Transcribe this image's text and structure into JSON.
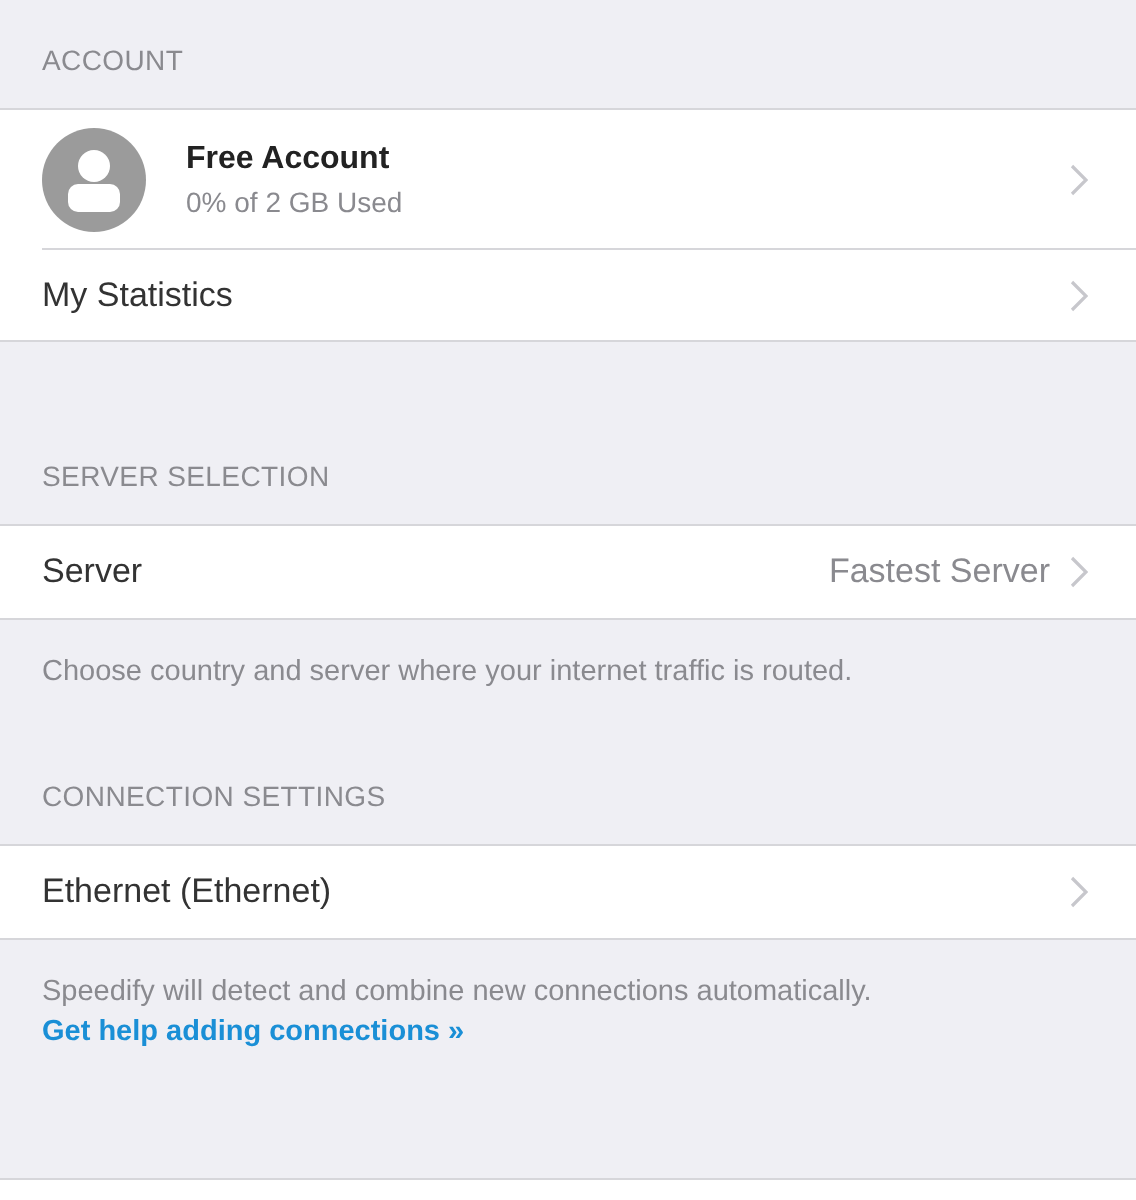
{
  "sections": [
    {
      "header": "ACCOUNT",
      "rows": [
        {
          "kind": "account",
          "title": "Free Account",
          "subtitle": "0% of 2 GB Used"
        },
        {
          "kind": "plain",
          "label": "My Statistics"
        }
      ]
    },
    {
      "header": "SERVER SELECTION",
      "rows": [
        {
          "kind": "value",
          "label": "Server",
          "value": "Fastest Server"
        }
      ],
      "note": {
        "text": "Choose country and server where your internet traffic is routed."
      }
    },
    {
      "header": "CONNECTION SETTINGS",
      "rows": [
        {
          "kind": "plain",
          "label": "Ethernet (Ethernet)"
        }
      ],
      "note": {
        "text": "Speedify will detect and combine new connections automatically.",
        "link": "Get help adding connections »"
      }
    }
  ]
}
